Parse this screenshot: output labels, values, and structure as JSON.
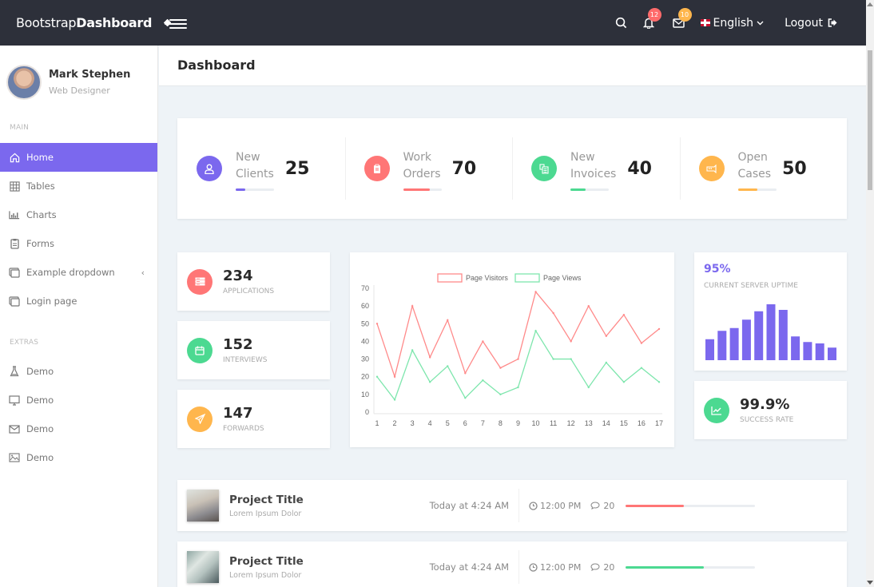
{
  "topbar": {
    "brand_regular": "Bootstrap",
    "brand_bold": "Dashboard",
    "notifications_count": "12",
    "messages_count": "10",
    "language": "English",
    "logout_label": "Logout"
  },
  "sidebar": {
    "user_name": "Mark Stephen",
    "user_role": "Web Designer",
    "main_section": "MAIN",
    "main_items": [
      {
        "label": "Home",
        "icon": "home-icon",
        "active": true
      },
      {
        "label": "Tables",
        "icon": "grid-icon"
      },
      {
        "label": "Charts",
        "icon": "bar-chart-icon"
      },
      {
        "label": "Forms",
        "icon": "clipboard-icon"
      },
      {
        "label": "Example dropdown",
        "icon": "windows-icon",
        "has_caret": true
      },
      {
        "label": "Login page",
        "icon": "windows-icon"
      }
    ],
    "extras_section": "EXTRAS",
    "extras_items": [
      {
        "label": "Demo",
        "icon": "flask-icon"
      },
      {
        "label": "Demo",
        "icon": "monitor-icon"
      },
      {
        "label": "Demo",
        "icon": "mail-icon"
      },
      {
        "label": "Demo",
        "icon": "image-icon"
      }
    ]
  },
  "page": {
    "title": "Dashboard"
  },
  "stats": [
    {
      "line1": "New",
      "line2": "Clients",
      "value": "25",
      "progress": 25,
      "color": "#7b68ee",
      "icon": "user-icon"
    },
    {
      "line1": "Work",
      "line2": "Orders",
      "value": "70",
      "progress": 70,
      "color": "#ff7676",
      "icon": "clipboard-icon"
    },
    {
      "line1": "New",
      "line2": "Invoices",
      "value": "40",
      "progress": 40,
      "color": "#4cd991",
      "icon": "invoice-icon"
    },
    {
      "line1": "Open",
      "line2": "Cases",
      "value": "50",
      "progress": 50,
      "color": "#ffb64d",
      "icon": "ticket-icon"
    }
  ],
  "mini_stats": [
    {
      "value": "234",
      "label": "Applications",
      "color": "#ff7676",
      "icon": "server-icon"
    },
    {
      "value": "152",
      "label": "Interviews",
      "color": "#4cd991",
      "icon": "calendar-icon"
    },
    {
      "value": "147",
      "label": "Forwards",
      "color": "#ffb64d",
      "icon": "paper-plane-icon"
    }
  ],
  "uptime": {
    "value": "95%",
    "label": "Current Server Uptime",
    "bars": [
      15,
      21,
      23,
      29,
      35,
      40,
      36,
      17,
      13,
      12,
      9
    ],
    "color": "#7b68ee"
  },
  "success": {
    "value": "99.9%",
    "label": "Success Rate",
    "color": "#4cd991",
    "icon": "trend-chart-icon"
  },
  "chart_data": {
    "type": "line",
    "title": "",
    "xlabel": "",
    "ylabel": "",
    "x": [
      1,
      2,
      3,
      4,
      5,
      6,
      7,
      8,
      9,
      10,
      11,
      12,
      13,
      14,
      15,
      16,
      17
    ],
    "ylim": [
      0,
      70
    ],
    "yticks": [
      0,
      10,
      20,
      30,
      40,
      50,
      60,
      70
    ],
    "legend_position": "top-center",
    "grid": false,
    "series": [
      {
        "name": "Page Visitors",
        "color": "#ff8a8a",
        "values": [
          50,
          20,
          60,
          31,
          52,
          22,
          40,
          25,
          30,
          68,
          56,
          40,
          60,
          43,
          55,
          39,
          47
        ]
      },
      {
        "name": "Page Views",
        "color": "#7ee6ad",
        "values": [
          20,
          7,
          35,
          17,
          26,
          8,
          18,
          10,
          14,
          46,
          30,
          30,
          14,
          28,
          17,
          25,
          17
        ]
      }
    ]
  },
  "projects": [
    {
      "title": "Project Title",
      "subtitle": "Lorem Ipsum Dolor",
      "date": "Today at 4:24 AM",
      "time": "12:00 PM",
      "comments": "20",
      "progress": 45,
      "color": "#ff7676"
    },
    {
      "title": "Project Title",
      "subtitle": "Lorem Ipsum Dolor",
      "date": "Today at 4:24 AM",
      "time": "12:00 PM",
      "comments": "20",
      "progress": 60,
      "color": "#4cd991"
    }
  ]
}
